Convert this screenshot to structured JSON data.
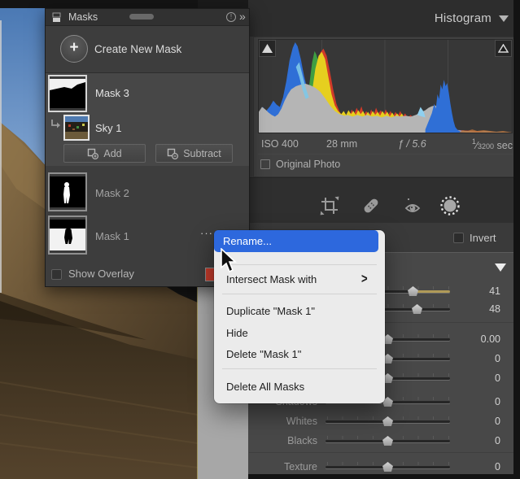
{
  "masks_panel": {
    "title": "Masks",
    "collapse_icon": "»",
    "create_label": "Create New Mask",
    "mask3_label": "Mask 3",
    "sky1_label": "Sky 1",
    "add_label": "Add",
    "subtract_label": "Subtract",
    "mask2_label": "Mask 2",
    "mask1_label": "Mask 1",
    "more_dots": "···",
    "show_overlay_label": "Show Overlay",
    "overlay_color": "#c23a2b"
  },
  "context_menu": {
    "rename": "Rename...",
    "intersect": "Intersect Mask with",
    "submenu_arrow": ">",
    "duplicate": "Duplicate \"Mask 1\"",
    "hide": "Hide",
    "delete_mask": "Delete \"Mask 1\"",
    "delete_all": "Delete All Masks",
    "highlight_color": "#2d68dd"
  },
  "histogram_panel": {
    "title": "Histogram",
    "iso": "ISO 400",
    "focal_length": "28 mm",
    "aperture": "ƒ / 5.6",
    "shutter_numerator": "1",
    "shutter_denominator": "3200",
    "shutter_unit": "sec",
    "original_photo_label": "Original Photo"
  },
  "tools_row": {
    "invert_label": "Invert"
  },
  "sliders": {
    "rows": [
      {
        "label": "",
        "value": "41"
      },
      {
        "label": "",
        "value": "48"
      },
      {
        "label": "",
        "value": "0.00"
      },
      {
        "label": "",
        "value": "0"
      },
      {
        "label": "",
        "value": "0"
      },
      {
        "label": "Shadows",
        "value": "0"
      },
      {
        "label": "Whites",
        "value": "0"
      },
      {
        "label": "Blacks",
        "value": "0"
      },
      {
        "label": "Texture",
        "value": "0"
      }
    ]
  }
}
